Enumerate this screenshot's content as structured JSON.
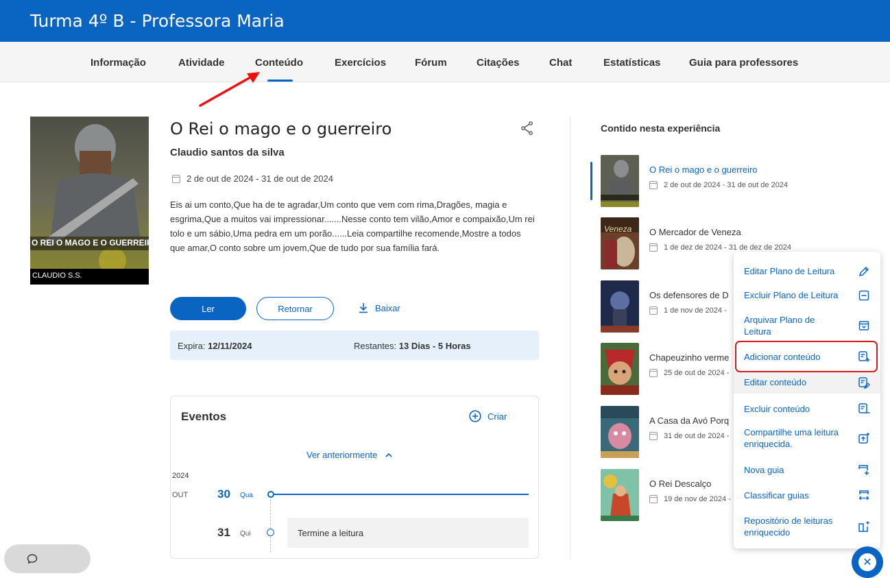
{
  "header": {
    "title": "Turma 4º B - Professora Maria"
  },
  "tabs": [
    "Informação",
    "Atividade",
    "Conteúdo",
    "Exercícios",
    "Fórum",
    "Citações",
    "Chat",
    "Estatísticas",
    "Guia para professores"
  ],
  "active_tab": "Conteúdo",
  "book": {
    "cover_title": "O REI O MAGO E O GUERREIRO",
    "cover_author": "CLAUDIO S.S.",
    "title": "O Rei o mago e o guerreiro",
    "author": "Claudio santos da silva",
    "dates": "2 de out de 2024 - 31 de out de 2024",
    "description": "Eis ai um conto,Que ha de te agradar,Um conto que vem com rima,Dragões, magia e esgrima,Que a muitos vai impressionar.......Nesse conto tem vilão,Amor e compaixão,Um rei tolo e um sábio,Uma pedra em um porão......Leia compartilhe recomende,Mostre a todos que amar,O conto sobre um jovem,Que de tudo por sua família fará."
  },
  "actions": {
    "read": "Ler",
    "return": "Retornar",
    "download": "Baixar"
  },
  "expiry": {
    "label": "Expira:",
    "date": "12/11/2024",
    "remaining_label": "Restantes:",
    "remaining": "13 Dias - 5 Horas"
  },
  "events": {
    "title": "Eventos",
    "create": "Criar",
    "see_previous": "Ver anteriormente",
    "year": "2024",
    "month": "OUT",
    "days": [
      {
        "day": "30",
        "weekday": "Qua"
      },
      {
        "day": "31",
        "weekday": "Qui",
        "task": "Termine a leitura"
      }
    ]
  },
  "sidebar": {
    "title": "Contido nesta experiência",
    "items": [
      {
        "name": "O Rei o mago e o guerreiro",
        "dates": "2 de out de 2024 - 31 de out de 2024"
      },
      {
        "name": "O Mercador de Veneza",
        "dates": "1 de dez de 2024 - 31 de dez de 2024",
        "thumb_text": "Veneza"
      },
      {
        "name": "Os defensores de D",
        "dates": "1 de nov de 2024 -"
      },
      {
        "name": "Chapeuzinho verme",
        "dates": "25 de out de 2024 -"
      },
      {
        "name": "A Casa da Avó Porq",
        "dates": "31 de out de 2024 -"
      },
      {
        "name": "O Rei Descalço",
        "dates": "19 de nov de 2024 -"
      }
    ]
  },
  "menu": {
    "items": [
      {
        "label": "Editar Plano de Leitura",
        "icon": "pencil-icon"
      },
      {
        "label": "Excluir Plano de Leitura",
        "icon": "minus-square-icon"
      },
      {
        "label": "Arquivar Plano de Leitura",
        "icon": "archive-icon"
      },
      {
        "label": "Adicionar conteúdo",
        "icon": "doc-add-icon"
      },
      {
        "label": "Editar conteúdo",
        "icon": "doc-edit-icon"
      },
      {
        "label": "Excluir conteúdo",
        "icon": "doc-remove-icon"
      },
      {
        "label": "Compartilhe uma leitura enriquecida.",
        "icon": "share-enriched-icon"
      },
      {
        "label": "Nova guia",
        "icon": "new-tab-icon"
      },
      {
        "label": "Classificar guias",
        "icon": "sort-tabs-icon"
      },
      {
        "label": "Repositório de leituras enriquecido",
        "icon": "book-add-icon"
      }
    ]
  },
  "colors": {
    "primary": "#0a64c2",
    "highlight": "#d61a1a",
    "expiry_bg": "#e6f0fb"
  }
}
